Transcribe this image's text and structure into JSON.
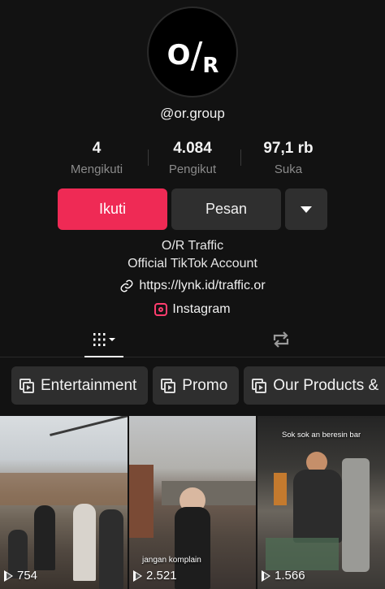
{
  "profile": {
    "avatar_text": "O/R",
    "handle": "@or.group",
    "stats": [
      {
        "value": "4",
        "label": "Mengikuti"
      },
      {
        "value": "4.084",
        "label": "Pengikut"
      },
      {
        "value": "97,1 rb",
        "label": "Suka"
      }
    ],
    "buttons": {
      "follow": "Ikuti",
      "message": "Pesan"
    },
    "bio_line1": "O/R Traffic",
    "bio_line2": "Official TikTok Account",
    "link": "https://lynk.id/traffic.or",
    "instagram": "Instagram"
  },
  "tabs": [
    {
      "icon": "grid-icon",
      "active": true
    },
    {
      "icon": "repost-icon",
      "active": false
    }
  ],
  "playlists": [
    "Entertainment",
    "Promo",
    "Our Products &"
  ],
  "videos": [
    {
      "views": "754",
      "caption": ""
    },
    {
      "views": "2.521",
      "caption": "jangan komplain"
    },
    {
      "views": "1.566",
      "caption": "Sok sok an beresin bar"
    }
  ],
  "colors": {
    "accent": "#ef2a55",
    "background": "#121212"
  }
}
